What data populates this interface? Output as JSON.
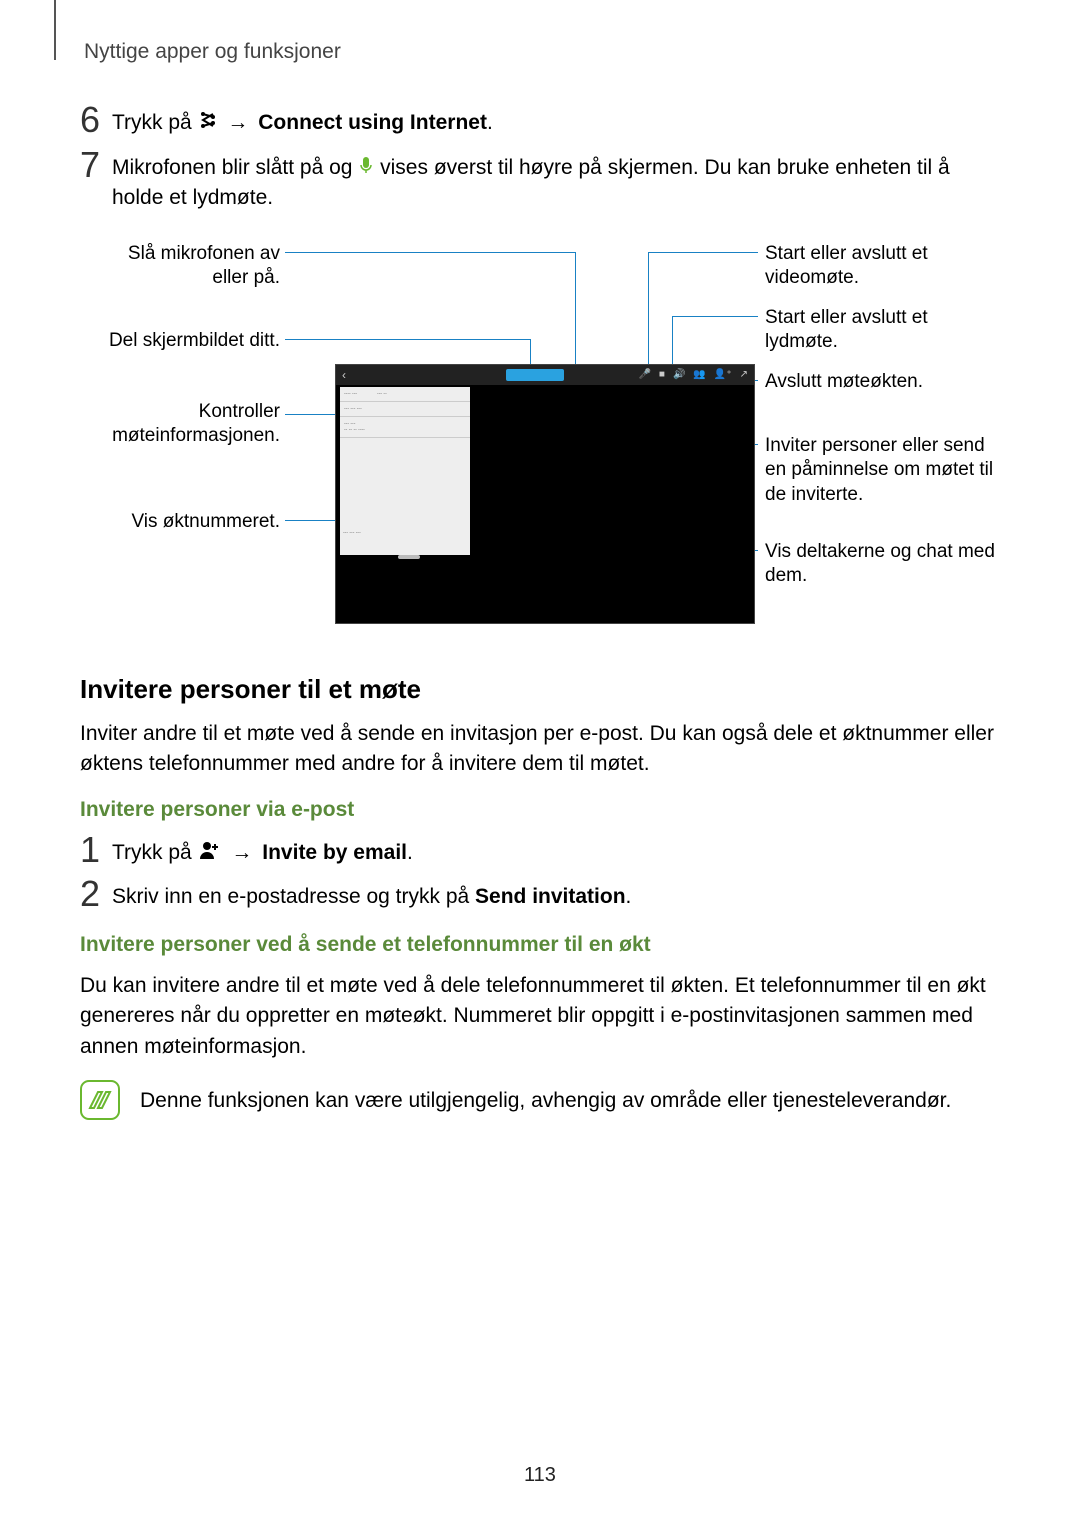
{
  "breadcrumb": "Nyttige apper og funksjoner",
  "step6": {
    "num": "6",
    "pre": "Trykk på ",
    "arrow": "→",
    "bold": "Connect using Internet",
    "post": "."
  },
  "step7": {
    "num": "7",
    "pre": "Mikrofonen blir slått på og ",
    "post": " vises øverst til høyre på skjermen. Du kan bruke enheten til å holde et lydmøte."
  },
  "diagram": {
    "left": {
      "mic": "Slå mikrofonen av eller på.",
      "share": "Del skjermbildet ditt.",
      "info": "Kontroller møteinformasjonen.",
      "session": "Vis øktnummeret."
    },
    "right": {
      "video": "Start eller avslutt et videomøte.",
      "audio": "Start eller avslutt et lydmøte.",
      "end": "Avslutt møteøkten.",
      "invite": "Inviter personer eller send en påminnelse om møtet til de inviterte.",
      "chat": "Vis deltakerne og chat med dem."
    }
  },
  "section_heading": "Invitere personer til et møte",
  "section_body": "Inviter andre til et møte ved å sende en invitasjon per e-post. Du kan også dele et øktnummer eller øktens telefonnummer med andre for å invitere dem til møtet.",
  "sub1": "Invitere personer via e-post",
  "step1": {
    "num": "1",
    "pre": "Trykk på ",
    "arrow": "→",
    "bold": "Invite by email",
    "post": "."
  },
  "step2": {
    "num": "2",
    "pre": "Skriv inn en e-postadresse og trykk på ",
    "bold": "Send invitation",
    "post": "."
  },
  "sub2": "Invitere personer ved å sende et telefonnummer til en økt",
  "body2": "Du kan invitere andre til et møte ved å dele telefonnummeret til økten. Et telefonnummer til en økt genereres når du oppretter en møteøkt. Nummeret blir oppgitt i e-postinvitasjonen sammen med annen møteinformasjon.",
  "note": "Denne funksjonen kan være utilgjengelig, avhengig av område eller tjenesteleverandør.",
  "page_number": "113"
}
